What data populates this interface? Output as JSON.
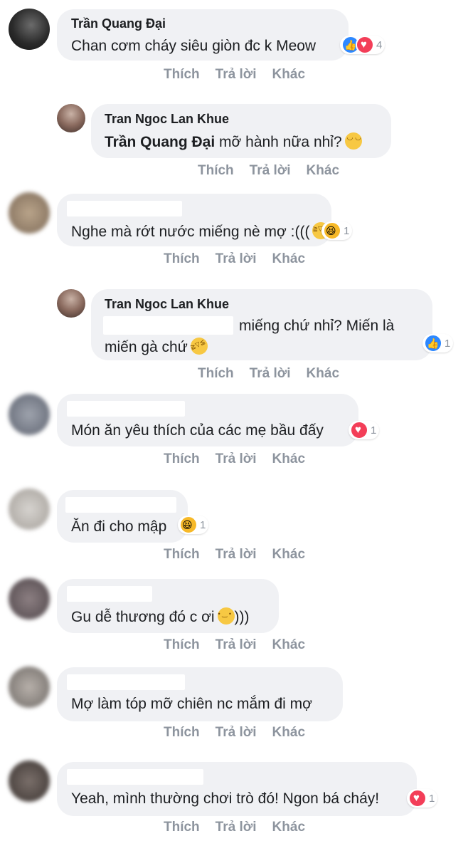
{
  "actions": {
    "like": "Thích",
    "reply": "Trả lời",
    "more": "Khác"
  },
  "comments": [
    {
      "author": "Trần Quang Đại",
      "text": "Chan cơm cháy siêu giòn đc k Meow",
      "reactions": "4"
    },
    {
      "author": "Tran Ngoc Lan Khue",
      "mention": "Trần Quang Đại",
      "text": " mỡ hành nữa nhỉ?"
    },
    {
      "author": "",
      "text": "Nghe mà rớt nước miếng nè mợ :(((",
      "reactions": "1"
    },
    {
      "author": "Tran Ngoc Lan Khue",
      "line1": "miếng chứ nhỉ? Miến là",
      "line2": "miến gà chứ",
      "reactions": "1"
    },
    {
      "author": "",
      "text": "Món ăn yêu thích của các mẹ bầu đấy",
      "reactions": "1"
    },
    {
      "author": "",
      "text": "Ăn đi cho mập",
      "reactions": "1"
    },
    {
      "author": "",
      "text": "Gu dễ thương đó c ơi",
      "text_after": ")))"
    },
    {
      "author": "",
      "text": "Mợ làm tóp mỡ chiên nc mắm đi mợ"
    },
    {
      "author": "",
      "text": "Yeah, mình thường chơi trò đó! Ngon bá cháy!",
      "reactions": "1"
    }
  ],
  "colors": {
    "bubble": "#f0f1f4",
    "action_text": "#8d949e",
    "like": "#2d88ff",
    "love": "#f33e58",
    "haha": "#f7b928"
  }
}
